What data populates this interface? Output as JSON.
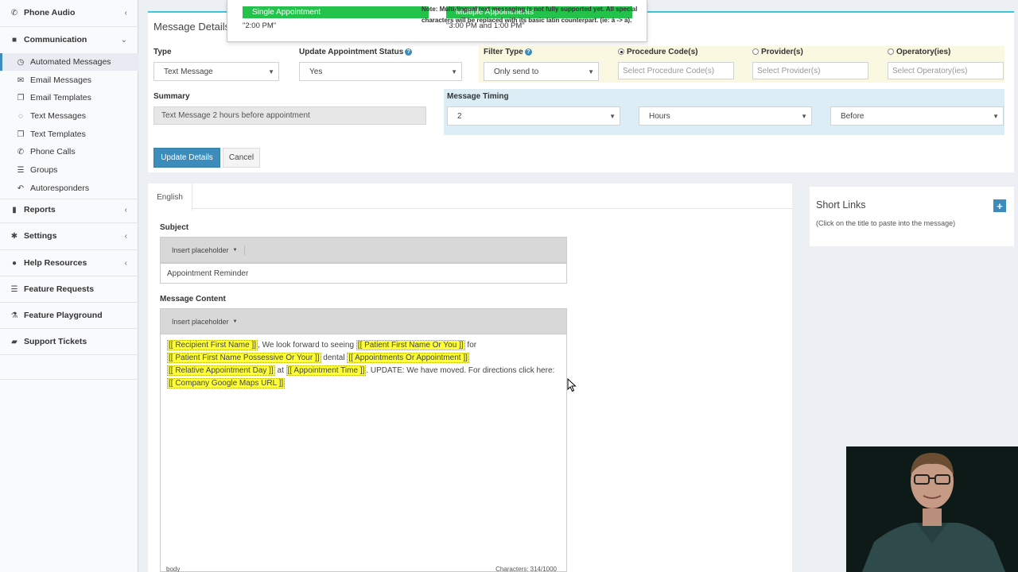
{
  "sidebar": {
    "items": [
      {
        "label": "Phone Audio",
        "icon": "phone-icon",
        "chevron": "‹"
      },
      {
        "label": "Communication",
        "icon": "comments-icon",
        "chevron": "⌄"
      },
      {
        "label": "Automated Messages",
        "icon": "clock-icon"
      },
      {
        "label": "Email Messages",
        "icon": "envelope-icon"
      },
      {
        "label": "Email Templates",
        "icon": "copy-icon"
      },
      {
        "label": "Text Messages",
        "icon": "speech-bubble-icon"
      },
      {
        "label": "Text Templates",
        "icon": "copy-icon"
      },
      {
        "label": "Phone Calls",
        "icon": "phone-icon"
      },
      {
        "label": "Groups",
        "icon": "list-icon"
      },
      {
        "label": "Autoresponders",
        "icon": "reply-icon"
      },
      {
        "label": "Reports",
        "icon": "chart-icon",
        "chevron": "‹"
      },
      {
        "label": "Settings",
        "icon": "gear-icon",
        "chevron": "‹"
      },
      {
        "label": "Help Resources",
        "icon": "info-icon",
        "chevron": "‹"
      },
      {
        "label": "Feature Requests",
        "icon": "list-icon"
      },
      {
        "label": "Feature Playground",
        "icon": "flask-icon"
      },
      {
        "label": "Support Tickets",
        "icon": "ticket-icon"
      }
    ]
  },
  "popup": {
    "single_label": "Single Appointment",
    "single_value": "\"2:00 PM\"",
    "multiple_label": "Multiple Appointments",
    "multiple_value": "\"3:00 PM and 1:00 PM\""
  },
  "details": {
    "title": "Message Details",
    "type_label": "Type",
    "type_value": "Text Message",
    "update_status_label": "Update Appointment Status",
    "update_status_value": "Yes",
    "filter_type_label": "Filter Type",
    "filter_type_value": "Only send to",
    "procedure_label": "Procedure Code(s)",
    "procedure_placeholder": "Select Procedure Code(s)",
    "provider_label": "Provider(s)",
    "provider_placeholder": "Select Provider(s)",
    "operatory_label": "Operatory(ies)",
    "operatory_placeholder": "Select Operatory(ies)",
    "summary_label": "Summary",
    "summary_value": "Text Message 2 hours before appointment",
    "timing_label": "Message Timing",
    "timing_amount": "2",
    "timing_unit": "Hours",
    "timing_relation": "Before",
    "update_button": "Update Details",
    "cancel_button": "Cancel"
  },
  "content": {
    "tab_label": "English",
    "note": "Note: Multi-lingual text messaging is not fully supported yet. All special characters will be replaced with its basic latin counterpart. (ie: á -> a).",
    "subject_label": "Subject",
    "insert_placeholder": "Insert placeholder",
    "subject_value": "Appointment Reminder",
    "message_label": "Message Content",
    "message": {
      "ph1": "[[ Recipient First Name ]]",
      "t1": ", We look forward to seeing ",
      "ph2": "[[ Patient First Name Or You ]]",
      "t2": " for",
      "ph3": "[[ Patient First Name Possessive Or Your ]]",
      "t3": " dental ",
      "ph4": "[[ Appointments Or Appointment ]]",
      "ph5": "[[ Relative Appointment Day ]]",
      "t4": " at ",
      "ph6": "[[ Appointment Time ]]",
      "t5": ". UPDATE: We have moved. For directions click here:",
      "ph7": "[[ Company Google Maps URL ]]"
    },
    "footer_left": "body",
    "footer_right": "Characters: 314/1000"
  },
  "short_links": {
    "title": "Short Links",
    "subtitle": "(Click on the title to paste into the message)",
    "add_symbol": "+"
  },
  "colors": {
    "primary": "#3c8dbc",
    "popup_header": "#22c24b",
    "placeholder_highlight": "#ffff33",
    "panel_accent": "#3cc6d9"
  }
}
